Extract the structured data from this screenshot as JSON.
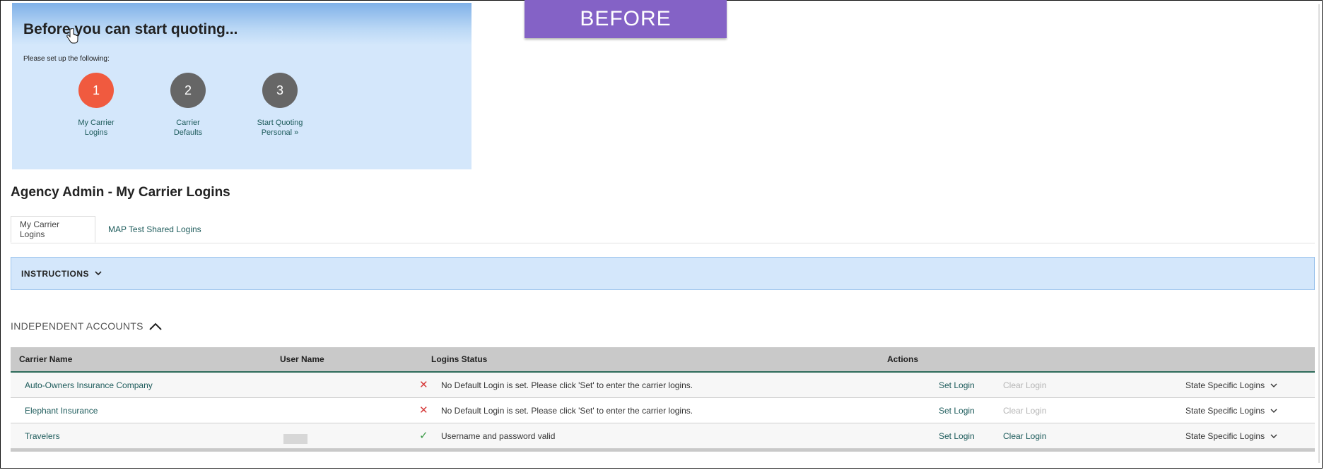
{
  "badge": "BEFORE",
  "setup": {
    "title": "Before you can start quoting...",
    "subtitle": "Please set up the following:",
    "steps": [
      {
        "number": "1",
        "line1": "My Carrier",
        "line2": "Logins",
        "color": "#f05a3f"
      },
      {
        "number": "2",
        "line1": "Carrier",
        "line2": "Defaults",
        "color": "#666666"
      },
      {
        "number": "3",
        "line1": "Start Quoting",
        "line2": "Personal »",
        "color": "#666666"
      }
    ]
  },
  "page_title": "Agency Admin - My Carrier Logins",
  "tabs": [
    {
      "label": "My Carrier Logins",
      "active": true
    },
    {
      "label": "MAP Test Shared Logins",
      "active": false
    }
  ],
  "instructions_label": "INSTRUCTIONS",
  "section_title": "INDEPENDENT ACCOUNTS",
  "table": {
    "headers": {
      "carrier": "Carrier Name",
      "user": "User Name",
      "status": "Logins Status",
      "actions": "Actions"
    },
    "rows": [
      {
        "carrier": "Auto-Owners Insurance Company",
        "status_icon": "x-icon",
        "status": "No Default Login is set. Please click 'Set' to enter the carrier logins.",
        "set": "Set Login",
        "clear": "Clear Login",
        "state": "State Specific Logins"
      },
      {
        "carrier": "Elephant Insurance",
        "status_icon": "x-icon",
        "status": "No Default Login is set. Please click 'Set' to enter the carrier logins.",
        "set": "Set Login",
        "clear": "Clear Login",
        "state": "State Specific Logins"
      },
      {
        "carrier": "Travelers",
        "status_icon": "check-icon",
        "status": "Username and password valid",
        "set": "Set Login",
        "clear": "Clear Login",
        "state": "State Specific Logins"
      }
    ]
  },
  "colors": {
    "accent": "#1d5b5b",
    "badge": "#8462c6",
    "panel": "#d4e7fb",
    "error": "#d63a3a",
    "success": "#3b9a47"
  }
}
